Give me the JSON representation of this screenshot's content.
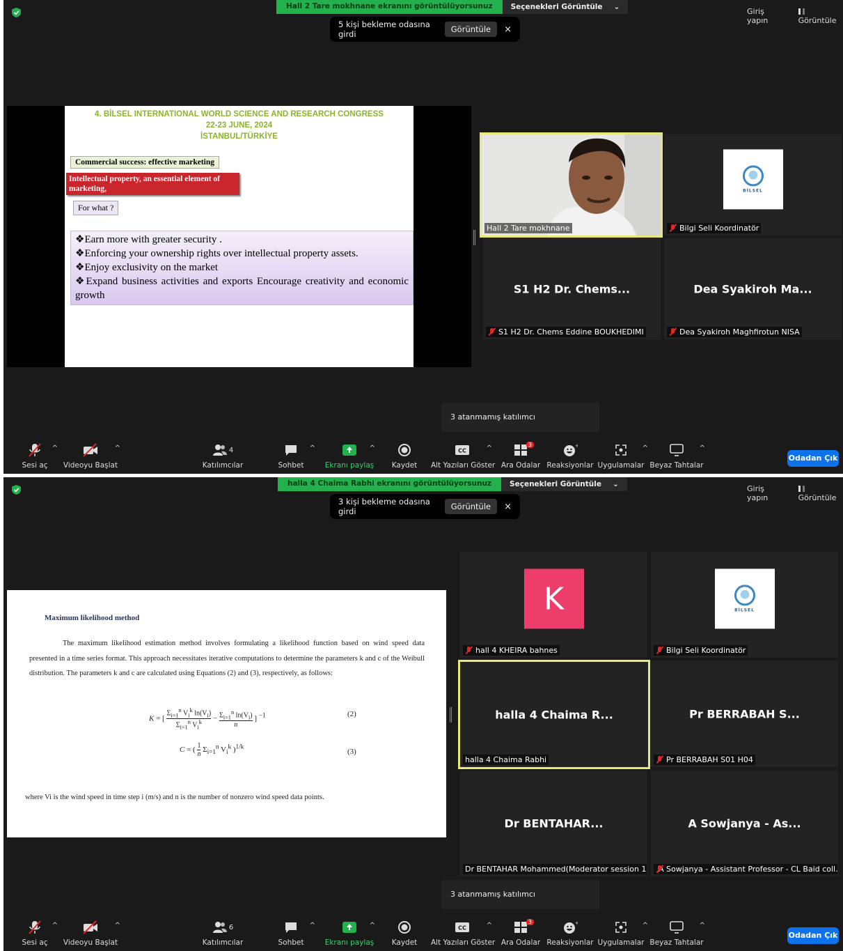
{
  "windows": [
    {
      "share_banner": "Hall 2 Tare mokhnane ekranını görüntülüyorsunuz",
      "view_options": "Seçenekleri Görüntüle",
      "login": "Giriş yapın",
      "view": "Görüntüle",
      "waiting": {
        "text": "5 kişi bekleme odasına girdi",
        "button": "Görüntüle",
        "close": "×"
      },
      "unassigned": "3 atanmamış katılımcı",
      "participants_count": "4",
      "slide": {
        "heading1": "4. BİLSEL INTERNATIONAL WORLD SCIENCE AND RESEARCH CONGRESS",
        "heading2": "22-23 JUNE, 2024",
        "heading3": "İSTANBUL/TÜRKİYE",
        "box1": "Commercial success: effective marketing",
        "box2": "Intellectual property, an essential element of marketing,",
        "box3": "For what ?",
        "bullets": [
          "❖Earn more with greater security .",
          "❖Enforcing your ownership rights over intellectual property assets.",
          "❖Enjoy exclusivity on the market",
          "❖Expand business activities and exports Encourage creativity and economic growth"
        ]
      },
      "tiles": [
        {
          "label": "Hall 2 Tare mokhnane",
          "big": ""
        },
        {
          "label": "Bilgi Seli Koordinatör",
          "big": ""
        },
        {
          "label": "S1 H2 Dr. Chems Eddine BOUKHEDIMI",
          "big": "S1 H2 Dr. Chems..."
        },
        {
          "label": "Dea Syakiroh Maghfirotun NISA",
          "big": "Dea Syakiroh Ma..."
        }
      ]
    },
    {
      "share_banner": "halla 4 Chaima Rabhi ekranını görüntülüyorsunuz",
      "view_options": "Seçenekleri Görüntüle",
      "login": "Giriş yapın",
      "view": "Görüntüle",
      "waiting": {
        "text": "3 kişi bekleme odasına girdi",
        "button": "Görüntüle",
        "close": "×"
      },
      "unassigned": "3 atanmamış katılımcı",
      "participants_count": "6",
      "doc": {
        "title": "Maximum likelihood method",
        "paragraph": "The maximum likelihood estimation method involves formulating a likelihood function based on wind speed data presented in a time series format. This approach necessitates iterative computations to determine the parameters k and c of the Weibull distribution. The parameters k and c are calculated using Equations (2) and (3), respectively, as follows:",
        "eq2_num": "(2)",
        "eq3_num": "(3)",
        "footer": "where Vi is the wind speed in time step i (m/s) and n is the number of nonzero wind speed data points."
      },
      "tiles": [
        {
          "label": "hall 4 KHEIRA bahnes",
          "big": "",
          "avatar": "K"
        },
        {
          "label": "Bilgi Seli Koordinatör",
          "big": ""
        },
        {
          "label": "halla 4 Chaima Rabhi",
          "big": "halla 4 Chaima R..."
        },
        {
          "label": "Pr BERRABAH  S01 H04",
          "big": "Pr BERRABAH  S..."
        },
        {
          "label": "Dr BENTAHAR Mohammed(Moderator session 1 ...",
          "big": "Dr  BENTAHAR..."
        },
        {
          "label": "A Sowjanya - Assistant Professor - CL Baid coll...",
          "big": "A Sowjanya - As..."
        }
      ]
    }
  ],
  "toolbar": {
    "unmute": "Sesi aç",
    "start_video": "Videoyu Başlat",
    "participants": "Katılımcılar",
    "chat": "Sohbet",
    "share": "Ekranı paylaş",
    "record": "Kaydet",
    "captions": "Alt Yazıları Göster",
    "breakout": "Ara Odalar",
    "breakout_badge": "3",
    "reactions": "Reaksiyonlar",
    "apps": "Uygulamalar",
    "whiteboards": "Beyaz Tahtalar",
    "leave": "Odadan Çık",
    "caret": "^",
    "chevron": "⌄"
  },
  "logo_text": "BİLSEL",
  "colors": {
    "accent": "#0e72ed",
    "share_green": "#22b14c",
    "active_border": "#e8e87a",
    "muted_red": "#e02828",
    "avatar_pink": "#ec3d6b"
  }
}
